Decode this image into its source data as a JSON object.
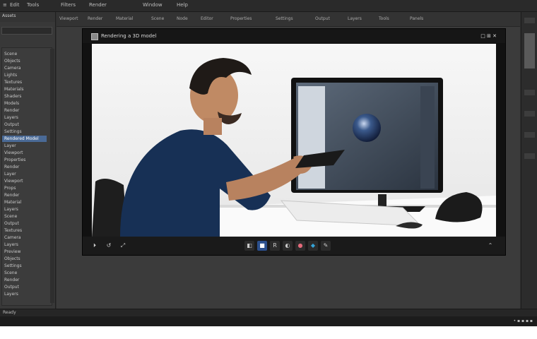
{
  "menu": [
    "Edit",
    "Tools",
    "Filters",
    "Render",
    "Window",
    "Help"
  ],
  "left_panel": {
    "title": "Assets",
    "tree": [
      "Scene",
      "Objects",
      "Camera",
      "Lights",
      "Textures",
      "Materials",
      "Shaders",
      "Models",
      "Render",
      "Layers",
      "Output",
      "Settings",
      "Rendered Model",
      "Layer",
      "Viewport",
      "Properties",
      "Render",
      "Layer",
      "Viewport",
      "Props",
      "Render",
      "Material",
      "Layers",
      "Scene",
      "Output",
      "Textures",
      "Camera",
      "Layers",
      "Preview",
      "Objects",
      "Settings",
      "Scene",
      "Render",
      "Output",
      "Layers"
    ],
    "selected_index": 12
  },
  "workspace_tabs": [
    "Viewport",
    "Render",
    "Material",
    "Scene",
    "Node",
    "Editor",
    "Properties",
    "Settings",
    "Output",
    "Layers",
    "Tools",
    "Panels"
  ],
  "viewer": {
    "title": "Rendering a 3D model",
    "right_text": "□ ⊞ ✕",
    "bar_left": [
      "⏵",
      "↺",
      "⤢"
    ],
    "bar_center": [
      "◧",
      "■",
      "R",
      "◐",
      "●",
      "◆",
      "✎"
    ],
    "bar_right": "⌃"
  },
  "status": {
    "left": "Ready",
    "tray": "• ▪ ▪ ▪ ▪"
  },
  "colors": {
    "accent": "#4a6a96",
    "background": "#2f2f2f"
  }
}
